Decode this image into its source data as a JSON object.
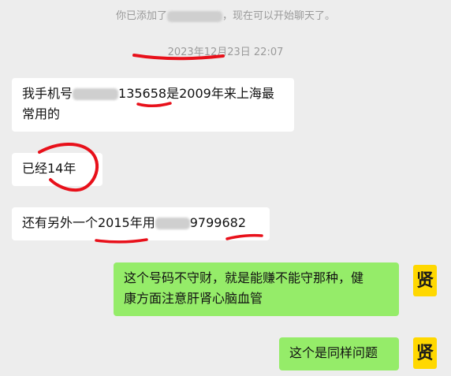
{
  "system": {
    "added_prefix": "你已添加了",
    "added_suffix": "，现在可以开始聊天了。",
    "timestamp": "2023年12月23日 22:07"
  },
  "messages": [
    {
      "side": "left",
      "part1": "我手机号",
      "part2": "135658是2009年来上海最",
      "line2": "常用的"
    },
    {
      "side": "left",
      "text": "已经14年"
    },
    {
      "side": "left",
      "part1": "还有另外一个2015年用",
      "part2": "9799682"
    },
    {
      "side": "right",
      "line1": "这个号码不守财，就是能赚不能守那种，健",
      "line2": "康方面注意肝肾心脑血管",
      "avatar": "贤"
    },
    {
      "side": "right",
      "text": "这个是同样问题",
      "avatar": "贤"
    }
  ],
  "colors": {
    "background": "#ededed",
    "incoming_bubble": "#ffffff",
    "outgoing_bubble": "#95ec69",
    "avatar": "#ffd800",
    "annotation_red": "#e8101a"
  }
}
